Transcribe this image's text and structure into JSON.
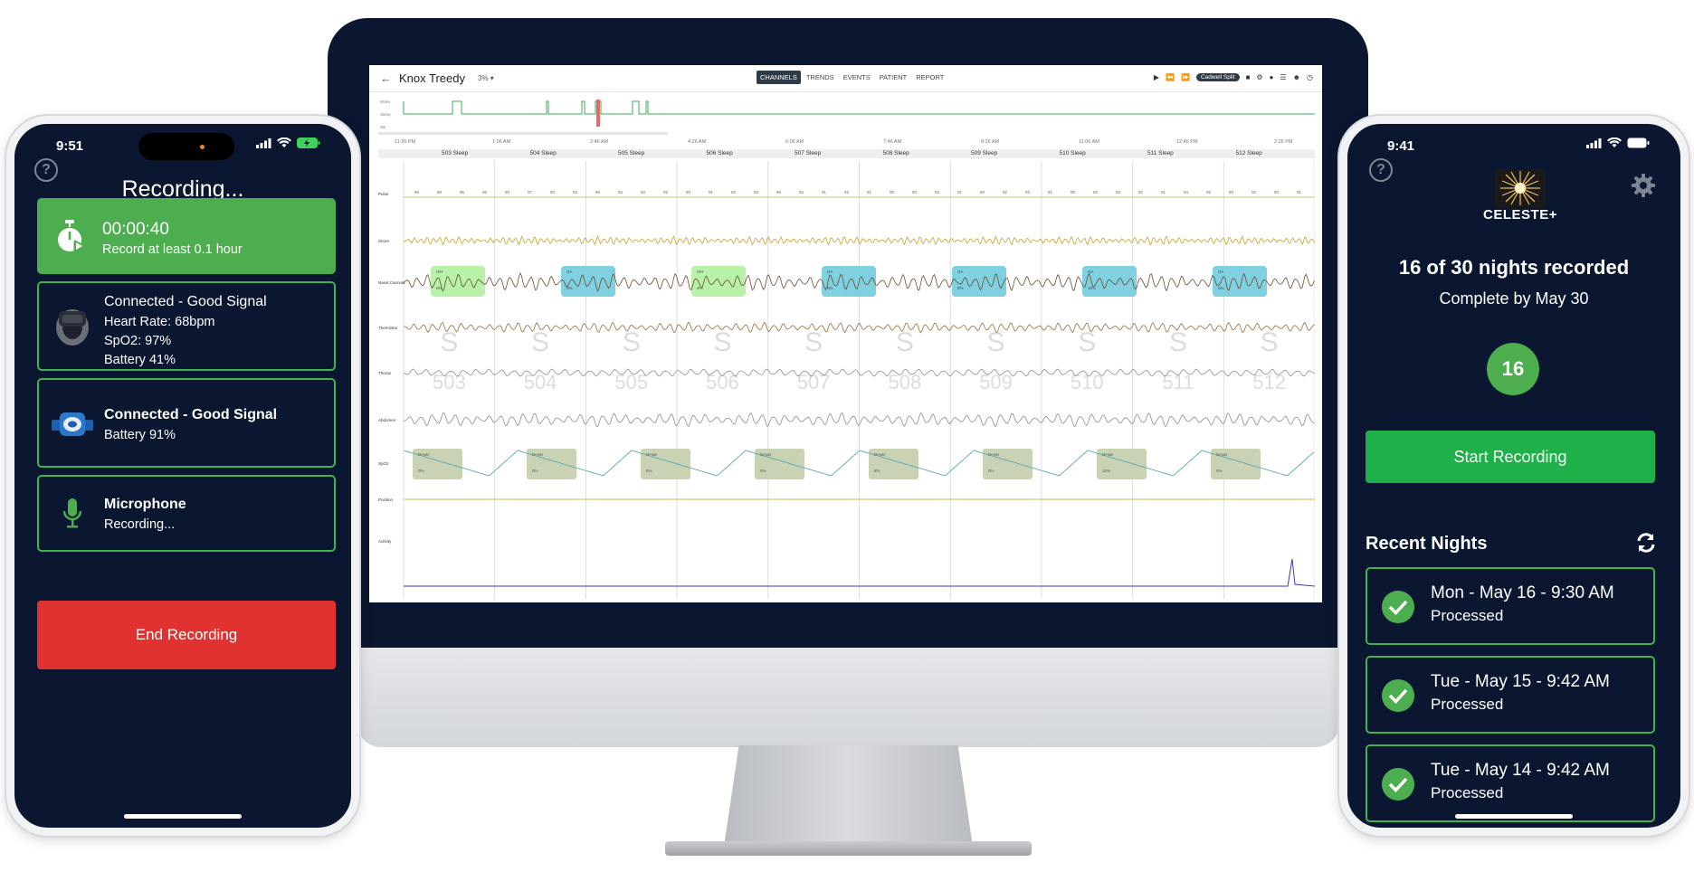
{
  "desktop": {
    "patient_name": "Knox Treedy",
    "zoom": "3% ▾",
    "tabs": [
      {
        "label": "CHANNELS",
        "active": true
      },
      {
        "label": "TRENDS",
        "active": false
      },
      {
        "label": "EVENTS",
        "active": false
      },
      {
        "label": "PATIENT",
        "active": false
      },
      {
        "label": "REPORT",
        "active": false
      }
    ],
    "cadwell_label": "Cadwell Split",
    "hypnogram_levels": [
      "Wake",
      "Sleep",
      "NB"
    ],
    "time_ticks": [
      "11:26 PM",
      "1:06 AM",
      "2:46 AM",
      "4:26 AM",
      "6:06 AM",
      "7:46 AM",
      "9:26 AM",
      "11:06 AM",
      "12:46 PM",
      "2:26 PM"
    ],
    "epochs": [
      "503 Sleep",
      "504 Sleep",
      "505 Sleep",
      "506 Sleep",
      "507 Sleep",
      "508 Sleep",
      "509 Sleep",
      "510 Sleep",
      "511 Sleep",
      "512 Sleep"
    ],
    "epoch_numbers": [
      "503",
      "504",
      "505",
      "506",
      "507",
      "508",
      "509",
      "510",
      "511",
      "512"
    ],
    "stage_letter": "S",
    "channels": [
      "Pulse",
      "Snore",
      "Nasal Cannula",
      "Thermistor",
      "Thorax",
      "Abdomen",
      "SpO2",
      "Position",
      "Activity"
    ],
    "pulse_values": [
      "96",
      "95",
      "95",
      "96",
      "90",
      "97",
      "93",
      "92",
      "96",
      "92",
      "93",
      "95",
      "90",
      "91",
      "92",
      "93",
      "96",
      "92",
      "91",
      "92",
      "91",
      "90",
      "93",
      "92",
      "91",
      "90",
      "92",
      "93",
      "91",
      "90",
      "92",
      "93",
      "92",
      "91",
      "94",
      "95",
      "90",
      "92",
      "93",
      "91"
    ],
    "nasal_events": [
      {
        "label": "OH",
        "pct": "0%",
        "type": "green"
      },
      {
        "label": "OA",
        "pct": "0%",
        "type": "blue"
      },
      {
        "label": "OH",
        "pct": "4%",
        "type": "green"
      },
      {
        "label": "OA",
        "pct": "0%",
        "type": "blue"
      },
      {
        "label": "OA",
        "pct": "8%",
        "type": "blue"
      },
      {
        "label": "OA",
        "pct": "10%",
        "type": "blue"
      },
      {
        "label": "OA",
        "pct": "0%",
        "type": "blue"
      }
    ],
    "desat_events": [
      {
        "label": "Desat",
        "pct": "0%"
      },
      {
        "label": "Desat",
        "pct": "0%"
      },
      {
        "label": "Desat",
        "pct": "0%"
      },
      {
        "label": "Desat",
        "pct": "0%"
      },
      {
        "label": "Desat",
        "pct": "8%"
      },
      {
        "label": "Desat",
        "pct": "0%"
      },
      {
        "label": "Desat",
        "pct": "10%"
      },
      {
        "label": "Desat",
        "pct": "0%"
      }
    ],
    "colors": {
      "pulse": "#b9b14a",
      "snore": "#c8a12a",
      "nasal": "#6b4a2f",
      "thermistor": "#9b6a3c",
      "thorax": "#8f8f8f",
      "abdomen": "#8c8c8c",
      "spo2": "#5aa6b8",
      "position": "#c4c13a",
      "activity": "#3d3aa8",
      "event_green": "#b8f2a8",
      "event_blue": "#7fd0e0",
      "event_desat": "#c9d2b2"
    }
  },
  "left_phone": {
    "time": "9:51",
    "title": "Recording...",
    "timer": {
      "value": "00:00:40",
      "note": "Record at least 0.1 hour"
    },
    "oximeter": {
      "title": "Connected - Good Signal",
      "heart_rate": "Heart Rate: 68bpm",
      "spo2": "SpO2: 97%",
      "battery": "Battery 41%"
    },
    "sensor": {
      "title": "Connected - Good Signal",
      "battery": "Battery 91%"
    },
    "microphone": {
      "title": "Microphone",
      "status": "Recording..."
    },
    "end_button": "End Recording"
  },
  "right_phone": {
    "time": "9:41",
    "logo": "CELESTE+",
    "progress_title": "16 of 30 nights recorded",
    "complete_by": "Complete by May 30",
    "nights_count": "16",
    "start_button": "Start Recording",
    "recent_title": "Recent Nights",
    "nights": [
      {
        "title": "Mon - May 16 - 9:30 AM",
        "status": "Processed"
      },
      {
        "title": "Tue - May 15 - 9:42 AM",
        "status": "Processed"
      },
      {
        "title": "Tue - May 14 - 9:42 AM",
        "status": "Processed"
      }
    ]
  }
}
